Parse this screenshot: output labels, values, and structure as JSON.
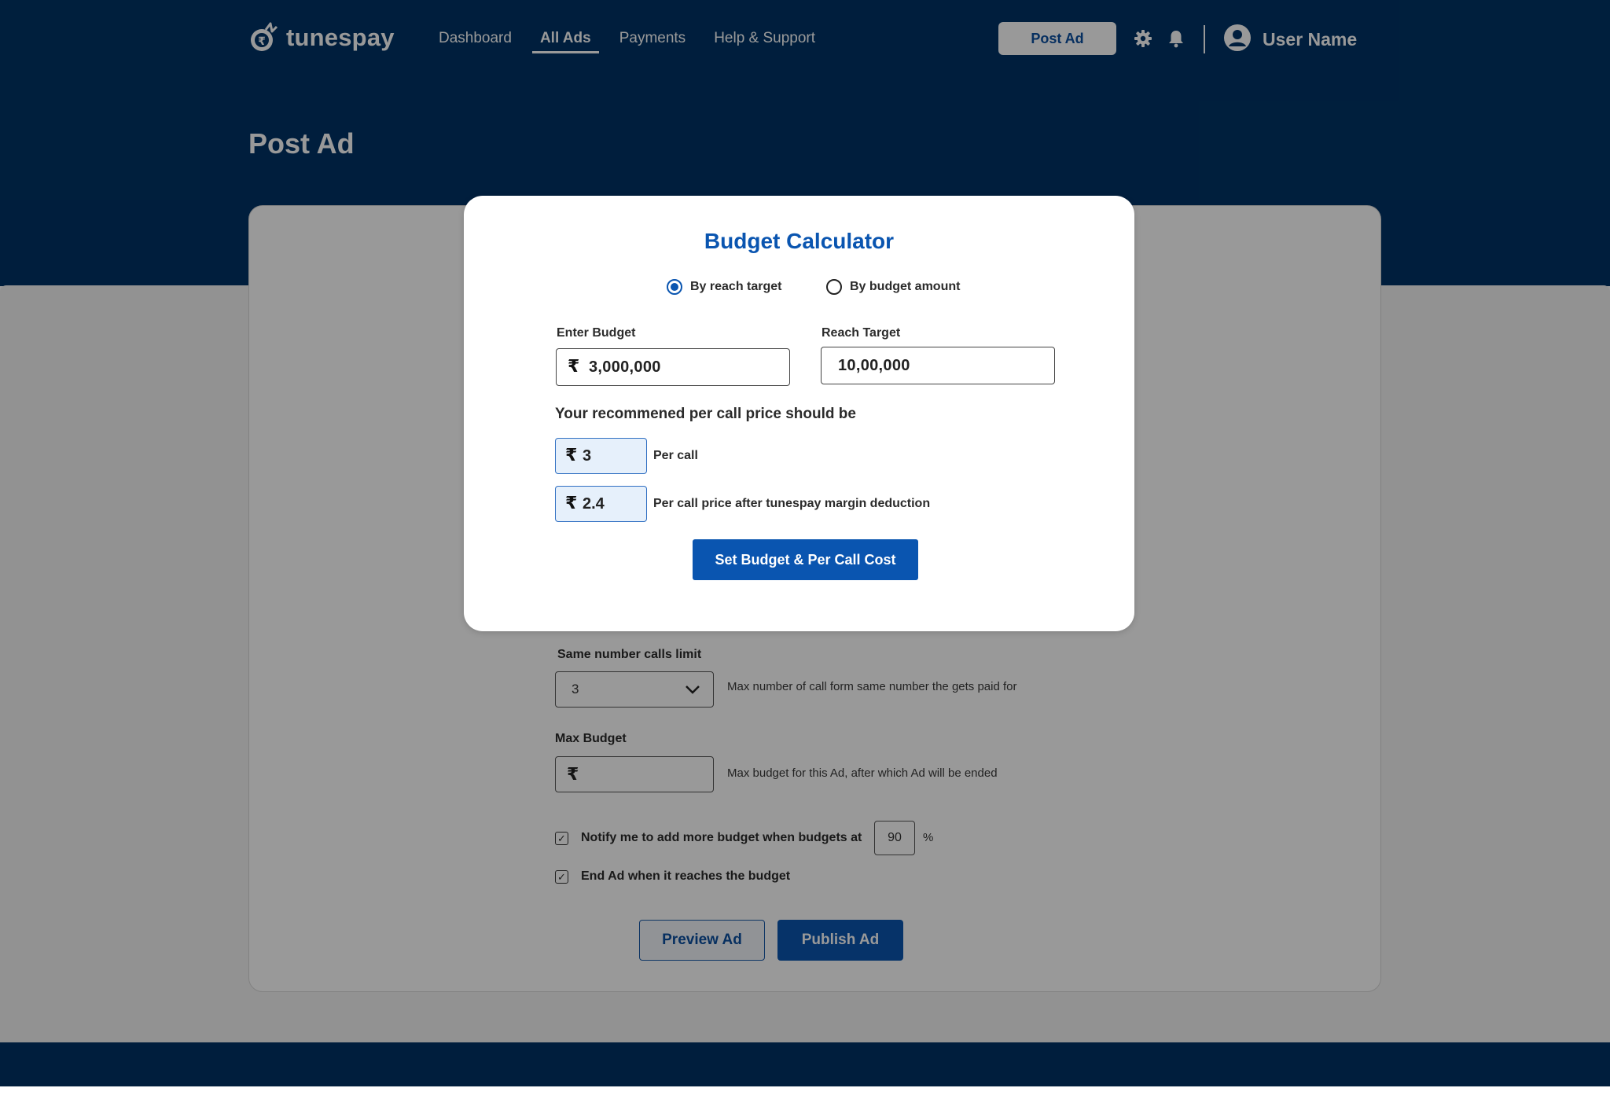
{
  "header": {
    "brand": "tunespay",
    "nav": [
      {
        "label": "Dashboard"
      },
      {
        "label": "All Ads"
      },
      {
        "label": "Payments"
      },
      {
        "label": "Help & Support"
      }
    ],
    "active_nav": "All Ads",
    "post_ad_button": "Post Ad",
    "icons": [
      "gear-icon",
      "bell-icon",
      "user-avatar-icon"
    ],
    "user_name": "User Name"
  },
  "page": {
    "title": "Post Ad"
  },
  "form": {
    "same_number_calls_limit": {
      "label": "Same number calls limit",
      "value": "3",
      "hint": "Max number of call form same number the gets paid for"
    },
    "max_budget": {
      "label": "Max Budget",
      "currency_symbol": "₹",
      "value": "",
      "hint": "Max budget for this Ad, after which Ad will be ended"
    },
    "notify": {
      "label": "Notify me to add more budget when budgets at",
      "checked": true,
      "percent_value": "90",
      "percent_sign": "%"
    },
    "end_ad": {
      "label": "End Ad when it reaches the budget",
      "checked": true
    },
    "preview_button": "Preview Ad",
    "publish_button": "Publish Ad"
  },
  "modal": {
    "title": "Budget Calculator",
    "mode_options": [
      {
        "label": "By reach target",
        "selected": true
      },
      {
        "label": "By budget amount",
        "selected": false
      }
    ],
    "enter_budget": {
      "label": "Enter Budget",
      "currency_symbol": "₹",
      "value": "3,000,000"
    },
    "reach_target": {
      "label": "Reach Target",
      "value": "10,00,000"
    },
    "recommendation_text": "Your recommened per call price should be",
    "per_call": {
      "currency_symbol": "₹",
      "value": "3",
      "label": "Per call"
    },
    "per_call_after_margin": {
      "currency_symbol": "₹",
      "value": "2.4",
      "label": "Per call price after tunespay margin deduction"
    },
    "set_button": "Set Budget & Per Call Cost"
  },
  "colors": {
    "brand_navy": "#003366",
    "primary_blue": "#0a55b0",
    "input_highlight": "#e6f0fb",
    "overlay": "rgba(0,0,0,0.40)"
  }
}
